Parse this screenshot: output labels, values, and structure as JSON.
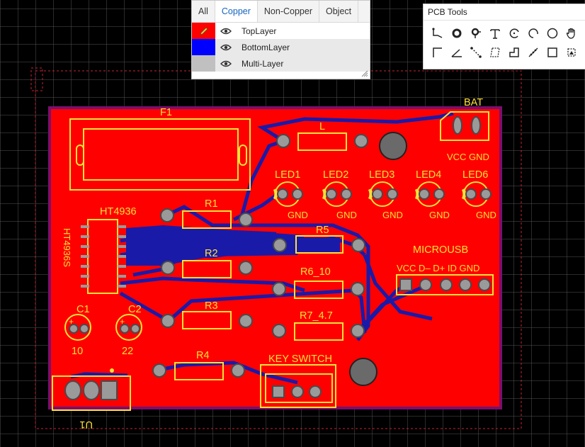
{
  "layers_panel": {
    "tabs": [
      {
        "label": "All",
        "active": false
      },
      {
        "label": "Copper",
        "active": true
      },
      {
        "label": "Non-Copper",
        "active": false
      },
      {
        "label": "Object",
        "active": false
      }
    ],
    "layers": [
      {
        "name": "TopLayer",
        "color": "#ff0000",
        "icon": "pencil-icon",
        "visible": true
      },
      {
        "name": "BottomLayer",
        "color": "#0000ff",
        "visible": true
      },
      {
        "name": "Multi-Layer",
        "color": "#c0c0c0",
        "visible": true
      }
    ]
  },
  "pcb_tools": {
    "title": "PCB Tools",
    "tools": [
      "track-tool-icon",
      "pad-tool-icon",
      "via-tool-icon",
      "text-tool-icon",
      "arc-tool-icon",
      "center-arc-tool-icon",
      "circle-tool-icon",
      "pan-hand-icon",
      "dimension-tool-icon",
      "angle-tool-icon",
      "connect-pad-tool-icon",
      "copper-area-tool-icon",
      "solid-region-tool-icon",
      "measure-tool-icon",
      "rectangle-tool-icon",
      "image-tool-icon"
    ]
  },
  "pcb": {
    "labels": {
      "f1": "F1",
      "bat": "BAT",
      "vcc_gnd": "VCC GND",
      "l": "L",
      "led1": "LED1",
      "led2": "LED2",
      "led3": "LED3",
      "led4": "LED4",
      "led6": "LED6",
      "gnd": "GND",
      "ht4936": "HT4936",
      "ht4936_rot": "HT4936S",
      "r1": "R1",
      "r2": "R2",
      "r3": "R3",
      "r4": "R4",
      "r5": "R5",
      "r6": "R6_10",
      "r7": "R7_4.7",
      "microusb": "MICROUSB",
      "usb_pins": "VCC D– D+ ID GND",
      "c1": "C1",
      "c2": "C2",
      "c1_val": "10",
      "c2_val": "22",
      "key_switch": "KEY SWITCH",
      "u1": "U1",
      "plus": "+"
    },
    "colors": {
      "background": "#000000",
      "grid": "#5a5a5a",
      "top_copper": "#ff0000",
      "bottom_copper": "#1a1aa8",
      "silkscreen": "#ffe23a",
      "pad": "#9a9a9a",
      "outline": "#c8c8c8",
      "board_edge": "#d01e8c"
    }
  }
}
